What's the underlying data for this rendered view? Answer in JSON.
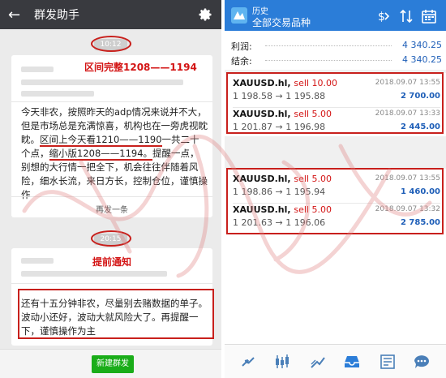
{
  "chat": {
    "title": "群发助手",
    "msg1": {
      "time": "10:12",
      "red_title": "区间完整1208——1194",
      "text_a": "今天非农，按照昨天的adp情况来说并不大，但是市场总是充满惊喜，机构也在一旁虎视眈眈。",
      "text_b": "区间上今天看1210——1190",
      "text_c": "一共二十个点，",
      "text_d": "缩小版1208——1194。",
      "text_e": "提醒一点，别想的大行情一把全下，机会往往伴随着风险，细水长流，来日方长，控制仓位，谨慎操作",
      "resend": "再发一条"
    },
    "msg2": {
      "time": "20:15",
      "red_title": "提前通知",
      "text": "还有十五分钟非农，尽量别去赌数据的单子。波动小还好，波动大就风险大了。再提醒一下，谨慎操作为主"
    },
    "new_group_btn": "新建群发"
  },
  "history": {
    "title_small": "历史",
    "title_main": "全部交易品种",
    "summary": [
      {
        "label": "利润:",
        "value": "4 340.25"
      },
      {
        "label": "结余:",
        "value": "4 340.25"
      }
    ],
    "group1": [
      {
        "symbol": "XAUUSD.hl,",
        "side": "sell 10.00",
        "price": "1 198.58 → 1 195.88",
        "date": "2018.09.07 13:55",
        "profit": "2 700.00"
      },
      {
        "symbol": "XAUUSD.hl,",
        "side": "sell 5.00",
        "price": "1 201.87 → 1 196.98",
        "date": "2018.09.07 13:33",
        "profit": "2 445.00"
      }
    ],
    "group2": [
      {
        "symbol": "XAUUSD.hl,",
        "side": "sell 5.00",
        "price": "1 198.86 → 1 195.94",
        "date": "2018.09.07 13:55",
        "profit": "1 460.00"
      },
      {
        "symbol": "XAUUSD.hl,",
        "side": "sell 5.00",
        "price": "1 201.63 → 1 196.06",
        "date": "2018.09.07 13:32",
        "profit": "2 785.00"
      }
    ]
  },
  "colors": {
    "accent_red": "#c8201c",
    "mt4_blue": "#2b7dd8",
    "wechat_green": "#1aad19"
  }
}
